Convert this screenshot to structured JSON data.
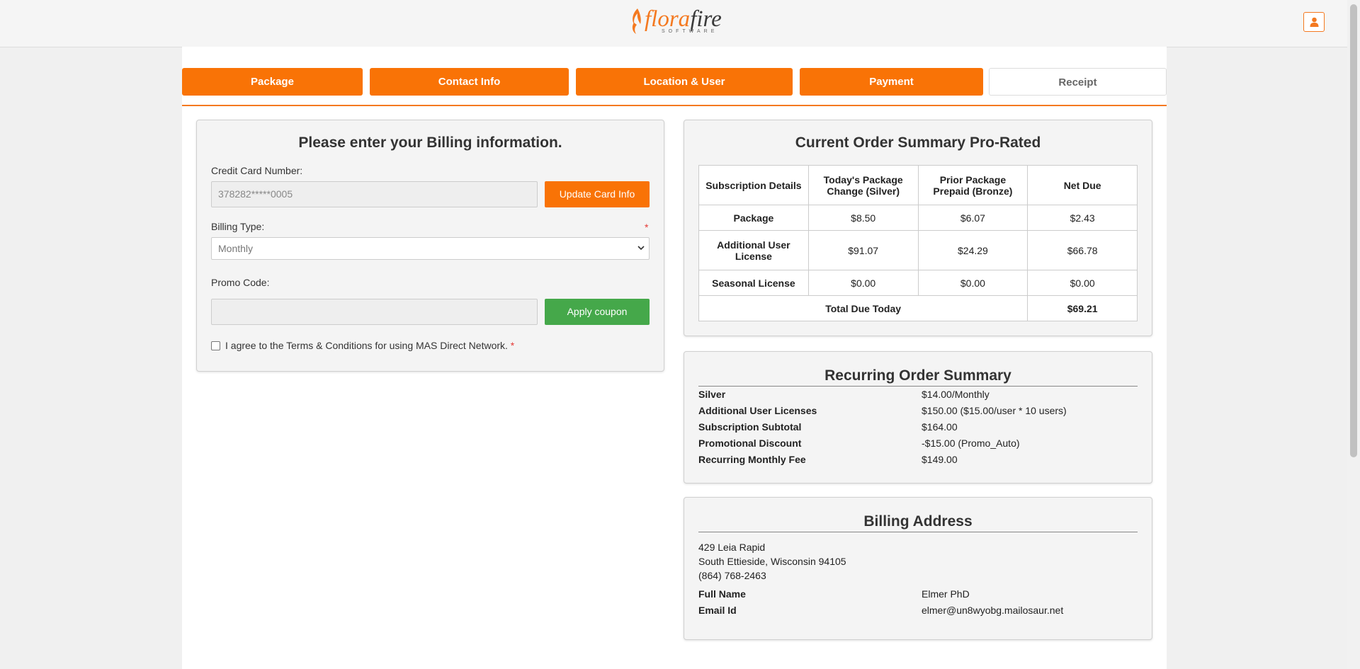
{
  "brand": {
    "name_part1": "flora",
    "name_part2": "fire",
    "subtitle": "SOFTWARE",
    "accent": "#f97306"
  },
  "header": {
    "user_icon": "user-icon"
  },
  "steps": [
    {
      "label": "Package",
      "active": true
    },
    {
      "label": "Contact Info",
      "active": true
    },
    {
      "label": "Location & User",
      "active": true
    },
    {
      "label": "Payment",
      "active": true
    },
    {
      "label": "Receipt",
      "active": false
    }
  ],
  "billing": {
    "title": "Please enter your Billing information.",
    "card_label": "Credit Card Number:",
    "card_value": "378282*****0005",
    "update_card_button": "Update Card Info",
    "billing_type_label": "Billing Type:",
    "required_mark": "*",
    "billing_type_value": "Monthly",
    "promo_label": "Promo Code:",
    "promo_value": "",
    "apply_button": "Apply coupon",
    "terms_text": "I agree to the Terms & Conditions for using MAS Direct Network."
  },
  "current_order": {
    "title": "Current Order Summary Pro-Rated",
    "headers": [
      "Subscription Details",
      "Today's Package Change (Silver)",
      "Prior Package Prepaid (Bronze)",
      "Net Due"
    ],
    "rows": [
      {
        "name": "Package",
        "today": "$8.50",
        "prior": "$6.07",
        "net": "$2.43"
      },
      {
        "name": "Additional User License",
        "today": "$91.07",
        "prior": "$24.29",
        "net": "$66.78"
      },
      {
        "name": "Seasonal License",
        "today": "$0.00",
        "prior": "$0.00",
        "net": "$0.00"
      }
    ],
    "total_label": "Total Due Today",
    "total_value": "$69.21"
  },
  "recurring": {
    "title": "Recurring Order Summary",
    "items": [
      {
        "label": "Silver",
        "value": "$14.00/Monthly"
      },
      {
        "label": "Additional User Licenses",
        "value": "$150.00 ($15.00/user * 10 users)"
      },
      {
        "label": "Subscription Subtotal",
        "value": "$164.00"
      },
      {
        "label": "Promotional Discount",
        "value": "-$15.00 (Promo_Auto)"
      },
      {
        "label": "Recurring Monthly Fee",
        "value": "$149.00"
      }
    ]
  },
  "billing_address": {
    "title": "Billing Address",
    "line1": "429 Leia Rapid",
    "line2": "South Ettieside, Wisconsin 94105",
    "phone": "(864) 768-2463",
    "full_name_label": "Full Name",
    "full_name": "Elmer PhD",
    "email_label": "Email Id",
    "email": "elmer@un8wyobg.mailosaur.net"
  }
}
